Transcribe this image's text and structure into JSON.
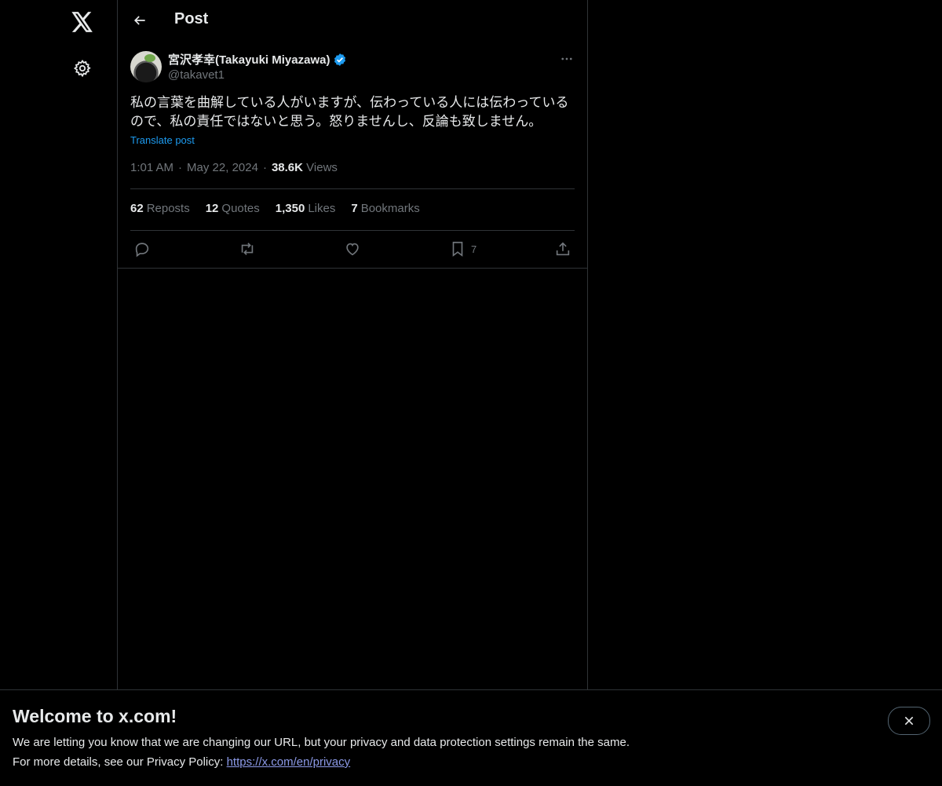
{
  "header": {
    "title": "Post"
  },
  "post": {
    "display_name": "宮沢孝幸(Takayuki Miyazawa)",
    "handle": "@takavet1",
    "text_line1": "私の言葉を曲解している人がいますが、伝わっている人には伝わっている",
    "text_line2": "ので、私の責任ではないと思う。怒りませんし、反論も致しません。",
    "translate_label": "Translate post",
    "time": "1:01 AM",
    "date": "May 22, 2024",
    "views_count": "38.6K",
    "views_label": "Views",
    "stats": {
      "reposts_count": "62",
      "reposts_label": "Reposts",
      "quotes_count": "12",
      "quotes_label": "Quotes",
      "likes_count": "1,350",
      "likes_label": "Likes",
      "bookmarks_count": "7",
      "bookmarks_label": "Bookmarks"
    },
    "actions": {
      "bookmark_count": "7"
    }
  },
  "banner": {
    "title": "Welcome to x.com!",
    "line1": "We are letting you know that we are changing our URL, but your privacy and data protection settings remain the same.",
    "line2_prefix": "For more details, see our Privacy Policy: ",
    "privacy_link": "https://x.com/en/privacy"
  },
  "icons": {
    "logo": "x-logo-icon",
    "settings": "gear-icon",
    "back": "arrow-left-icon",
    "verified": "verified-badge-icon",
    "more": "more-horizontal-icon",
    "reply": "reply-icon",
    "repost": "repost-icon",
    "like": "heart-icon",
    "bookmark": "bookmark-icon",
    "share": "share-icon",
    "close": "close-icon"
  },
  "colors": {
    "background": "#000000",
    "text": "#e7e9ea",
    "muted": "#71767b",
    "accent": "#1d9bf0",
    "border": "#2f3336"
  }
}
